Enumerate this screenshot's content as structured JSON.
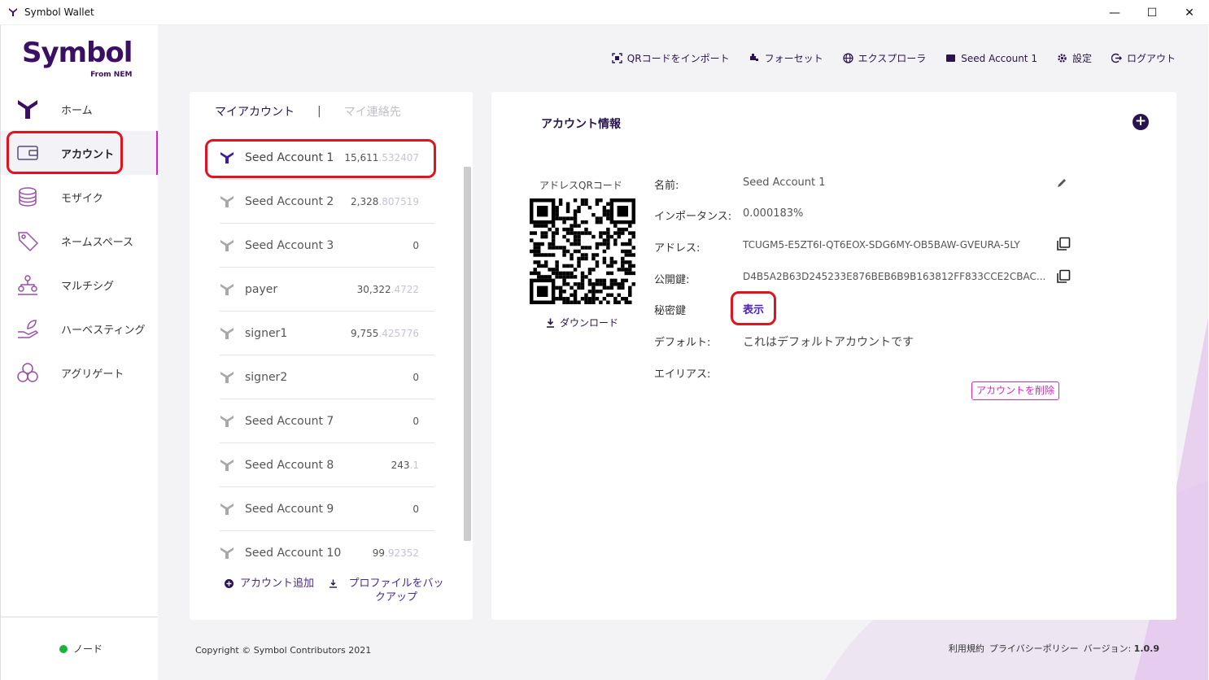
{
  "window": {
    "title": "Symbol Wallet",
    "controls": [
      "—",
      "☐",
      "✕"
    ]
  },
  "brand": {
    "word": "Symbol",
    "tagline": "From NEM"
  },
  "sidebar": {
    "items": [
      {
        "label": "ホーム",
        "icon": "symbol-logo-icon"
      },
      {
        "label": "アカウント",
        "icon": "wallet-icon",
        "active": true
      },
      {
        "label": "モザイク",
        "icon": "coins-icon"
      },
      {
        "label": "ネームスペース",
        "icon": "tag-icon"
      },
      {
        "label": "マルチシグ",
        "icon": "multisig-icon"
      },
      {
        "label": "ハーベスティング",
        "icon": "harvest-icon"
      },
      {
        "label": "アグリゲート",
        "icon": "aggregate-icon"
      }
    ],
    "node_label": "ノード",
    "node_status_color": "#19b33b"
  },
  "topnav": {
    "import_qr": "QRコードをインポート",
    "faucet": "フォーセット",
    "explorer": "エクスプローラ",
    "account": "Seed Account 1",
    "settings": "設定",
    "logout": "ログアウト"
  },
  "accounts_panel": {
    "tab_my_accounts": "マイアカウント",
    "tab_separator": "|",
    "tab_contacts": "マイ連絡先",
    "accounts": [
      {
        "name": "Seed Account 1",
        "balance_int": "15,611",
        "balance_dec": ".532407",
        "selected": true
      },
      {
        "name": "Seed Account 2",
        "balance_int": "2,328",
        "balance_dec": ".807519"
      },
      {
        "name": "Seed Account 3",
        "balance_int": "0",
        "balance_dec": ""
      },
      {
        "name": "payer",
        "balance_int": "30,322",
        "balance_dec": ".4722"
      },
      {
        "name": "signer1",
        "balance_int": "9,755",
        "balance_dec": ".425776"
      },
      {
        "name": "signer2",
        "balance_int": "0",
        "balance_dec": ""
      },
      {
        "name": "Seed Account 7",
        "balance_int": "0",
        "balance_dec": ""
      },
      {
        "name": "Seed Account 8",
        "balance_int": "243",
        "balance_dec": ".1"
      },
      {
        "name": "Seed Account 9",
        "balance_int": "0",
        "balance_dec": ""
      },
      {
        "name": "Seed Account 10",
        "balance_int": "99",
        "balance_dec": ".92352"
      }
    ],
    "add_account": "アカウント追加",
    "backup_profile": "プロファイルをバックアップ"
  },
  "detail": {
    "heading": "アカウント情報",
    "add_symbol": "+",
    "qr_label": "アドレスQRコード",
    "download": "ダウンロード",
    "fields": {
      "name_key": "名前:",
      "name_value": "Seed Account 1",
      "importance_key": "インポータンス:",
      "importance_value": "0.000183%",
      "address_key": "アドレス:",
      "address_value": "TCUGM5-E5ZT6I-QT6EOX-SDG6MY-OB5BAW-GVEURA-5LY",
      "pubkey_key": "公開鍵:",
      "pubkey_value": "D4B5A2B63D245233E876BEB6B9B163812FF833CCE2CBAC...",
      "privkey_key": "秘密鍵",
      "privkey_reveal": "表示",
      "default_key": "デフォルト:",
      "default_value": "これはデフォルトアカウントです",
      "alias_key": "エイリアス:"
    },
    "delete_button": "アカウントを削除"
  },
  "footer": {
    "copyright": "Copyright © Symbol Contributors 2021",
    "terms": "利用規約",
    "privacy": "プライバシーポリシー",
    "version_label": "バージョン:",
    "version": "1.0.9"
  },
  "colors": {
    "brand_purple": "#2a1450",
    "accent_magenta": "#e020d0",
    "annotation_red": "#e0141e"
  }
}
